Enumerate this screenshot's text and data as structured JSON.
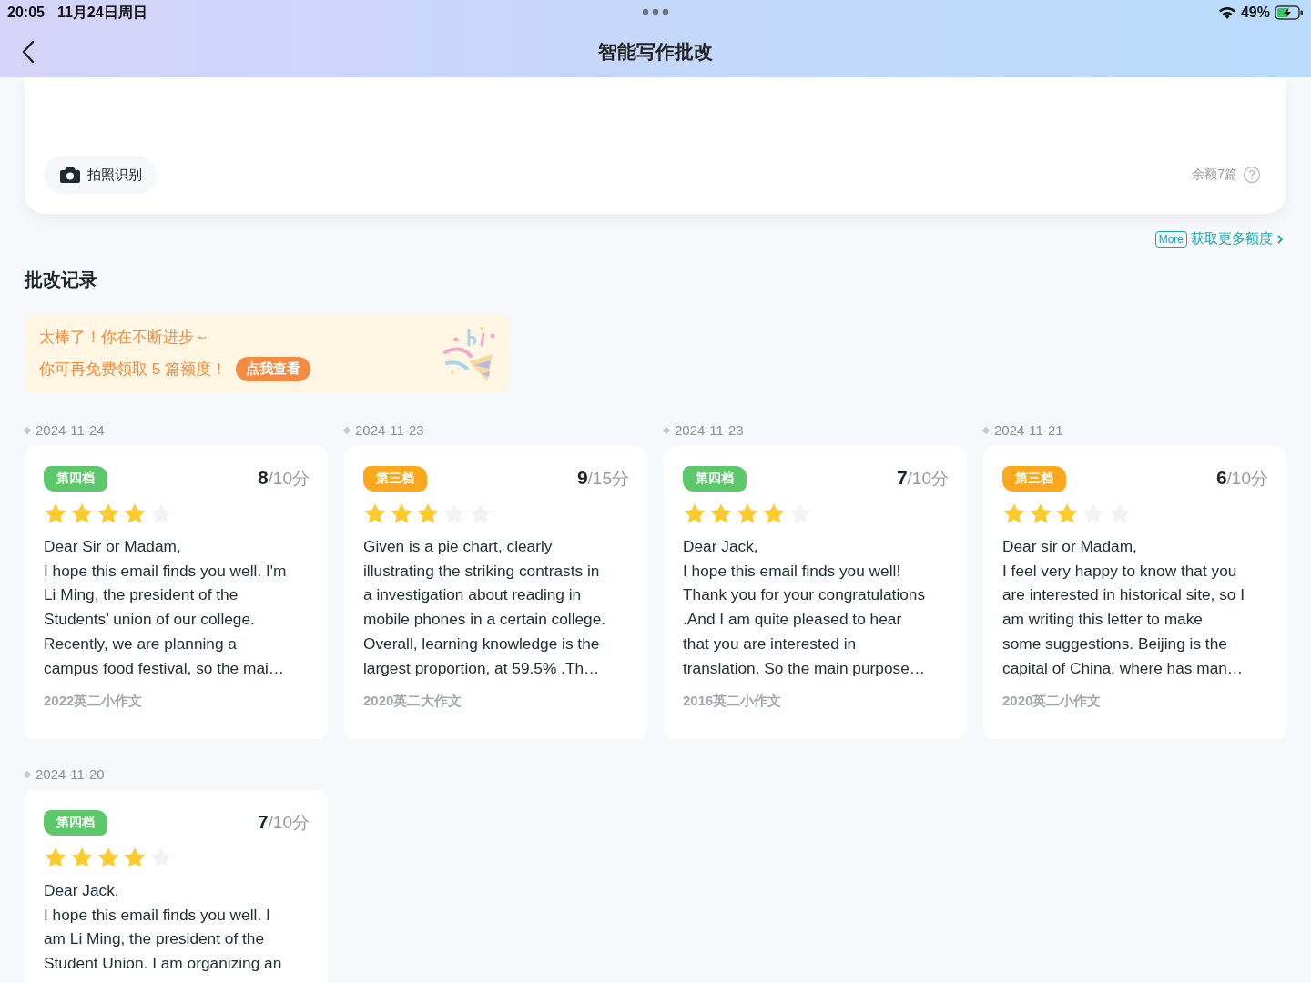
{
  "status_bar": {
    "time": "20:05",
    "date": "11月24日周日",
    "battery": "49%"
  },
  "nav": {
    "title": "智能写作批改"
  },
  "input_card": {
    "photo_button": "拍照识别",
    "quota": "余额7篇"
  },
  "more_link": {
    "badge": "More",
    "label": "获取更多额度"
  },
  "section_title": "批改记录",
  "banner": {
    "line1": "太棒了！你在不断进步～",
    "line2": "你可再免费领取 5 篇额度！",
    "button": "点我查看"
  },
  "records": [
    {
      "date": "2024-11-24",
      "grade": "第四档",
      "color": "#5cc86a",
      "score": "8",
      "total": "/10分",
      "stars": 4,
      "text": "Dear Sir or Madam,\nI hope this email finds you well. I'm\nLi Ming, the president of the\nStudents’ union of our college.\nRecently, we are planning a\ncampus food festival, so the mai…",
      "exam": "2022英二小作文"
    },
    {
      "date": "2024-11-23",
      "grade": "第三档",
      "color": "#fba81c",
      "score": "9",
      "total": "/15分",
      "stars": 3,
      "text": "Given is a pie chart, clearly\nillustrating the striking contrasts in\na investigation about reading in\nmobile phones in a certain college.\nOverall, learning knowledge is the\nlargest proportion, at 59.5% .Th…",
      "exam": "2020英二大作文"
    },
    {
      "date": "2024-11-23",
      "grade": "第四档",
      "color": "#5cc86a",
      "score": "7",
      "total": "/10分",
      "stars": 4,
      "text": "Dear Jack,\nI hope this email finds you well!\nThank you for your congratulations\n.And I am quite pleased to hear\nthat you are interested in\ntranslation. So the main purpose…",
      "exam": "2016英二小作文"
    },
    {
      "date": "2024-11-21",
      "grade": "第三档",
      "color": "#fba81c",
      "score": "6",
      "total": "/10分",
      "stars": 3,
      "text": "Dear sir or Madam,\nI feel very happy to know that you\nare interested in historical site, so I\nam writing this letter to make\nsome suggestions. Beijing is the\ncapital of China, where has man…",
      "exam": "2020英二小作文"
    },
    {
      "date": "2024-11-20",
      "grade": "第四档",
      "color": "#5cc86a",
      "score": "7",
      "total": "/10分",
      "stars": 4,
      "text": "Dear Jack,\nI hope this email finds you well. I\nam Li Ming, the president of the\nStudent Union. I am organizing an"
    }
  ]
}
